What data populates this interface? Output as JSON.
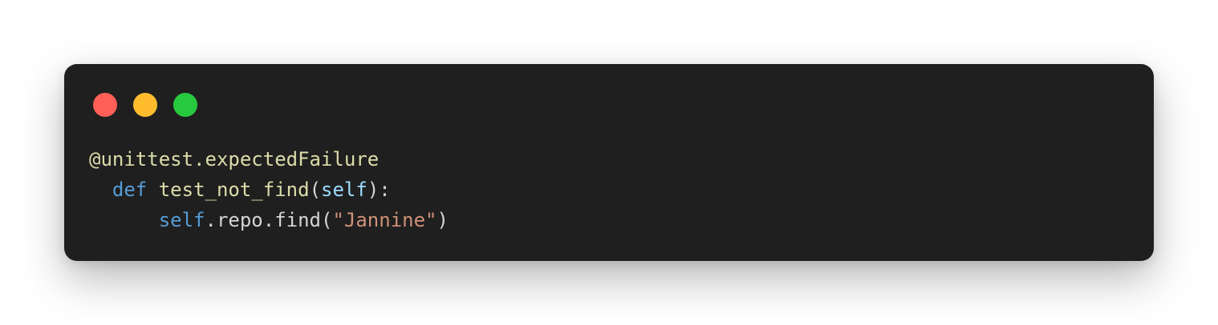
{
  "colors": {
    "background": "#ffffff",
    "window": "#1f1f1f",
    "window_close": "#ff5f56",
    "window_minimize": "#ffbd2e",
    "window_maximize": "#27c93f",
    "decorator": "#dcdcaa",
    "keyword": "#569cd6",
    "function_name": "#dcdcaa",
    "parameter": "#9cdcfe",
    "punctuation": "#d4d4d4",
    "string": "#ce9178"
  },
  "code": {
    "lines": [
      [
        {
          "text": "@unittest.expectedFailure",
          "kind": "decorator"
        }
      ],
      [
        {
          "text": "  ",
          "kind": "punctuation"
        },
        {
          "text": "def",
          "kind": "keyword"
        },
        {
          "text": " ",
          "kind": "punctuation"
        },
        {
          "text": "test_not_find",
          "kind": "function_name"
        },
        {
          "text": "(",
          "kind": "punctuation"
        },
        {
          "text": "self",
          "kind": "parameter"
        },
        {
          "text": "):",
          "kind": "punctuation"
        }
      ],
      [
        {
          "text": "      ",
          "kind": "punctuation"
        },
        {
          "text": "self",
          "kind": "keyword"
        },
        {
          "text": ".repo.find(",
          "kind": "punctuation"
        },
        {
          "text": "\"Jannine\"",
          "kind": "string"
        },
        {
          "text": ")",
          "kind": "punctuation"
        }
      ]
    ]
  }
}
